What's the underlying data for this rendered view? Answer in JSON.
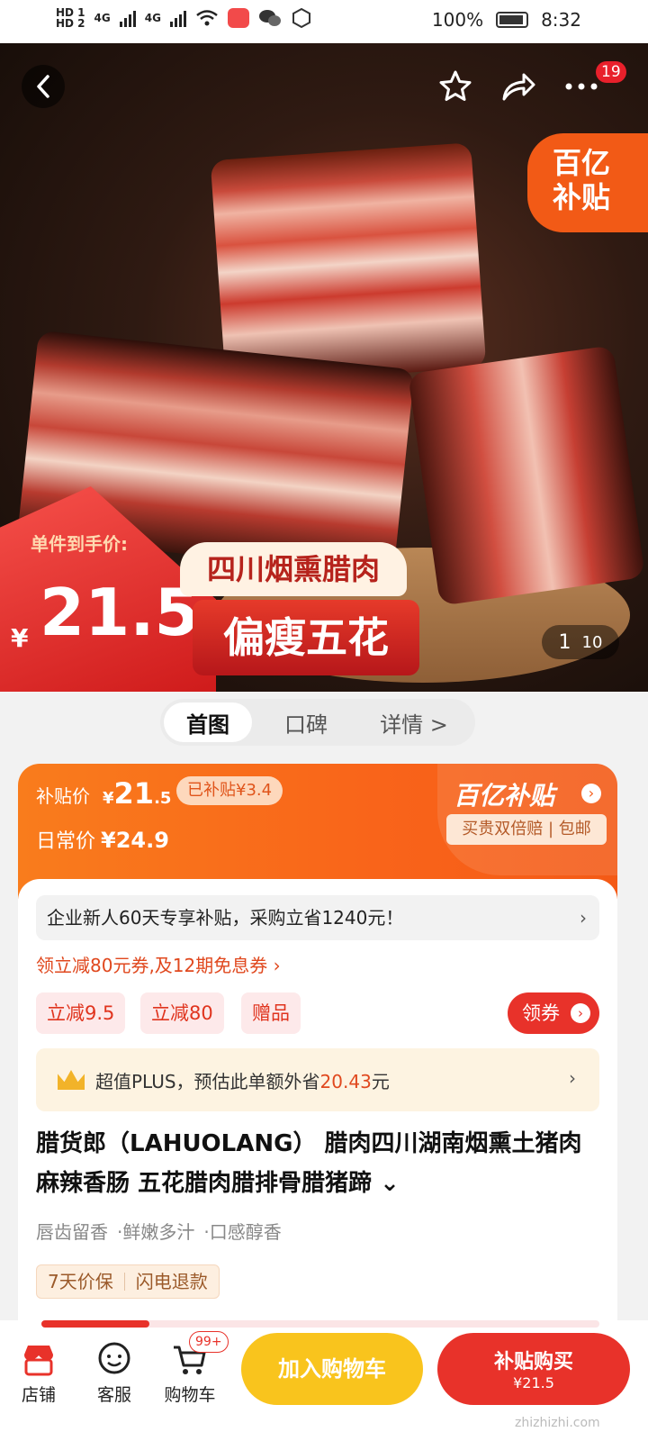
{
  "status_bar": {
    "sim1": "HD 1",
    "sim2": "HD 2",
    "net1": "4G",
    "net2": "4G",
    "battery": "100%",
    "time": "8:32"
  },
  "hero": {
    "fav_icon": "star-icon",
    "share_icon": "share-icon",
    "more_icon": "more-dots-icon",
    "notification_count": "19",
    "yiyi_badge_line1": "百亿",
    "yiyi_badge_line2": "补贴",
    "price_label": "单件到手价:",
    "price_currency": "¥",
    "price_value": "21.5",
    "tag_title": "四川烟熏腊肉",
    "tag_sub": "偏瘦五花",
    "page_current": "1",
    "page_total": "10"
  },
  "tabs": [
    {
      "label": "首图",
      "active": true
    },
    {
      "label": "口碑",
      "active": false
    },
    {
      "label": "详情 >",
      "active": false
    }
  ],
  "subsidy": {
    "label": "补贴价",
    "currency": "¥",
    "price_int": "21",
    "price_dec": ".5",
    "saved": "已补贴¥3.4",
    "regular_label": "日常价",
    "regular_price": "¥24.9",
    "brand": "百亿补贴",
    "guarantee": "买贵双倍赔 | 包邮"
  },
  "promo": {
    "enterprise": "企业新人60天专享补贴，采购立省1240元！",
    "coupon_line": "领立减80元券,及12期免息券 ›",
    "chips": [
      "立减9.5",
      "立减80",
      "赠品"
    ],
    "coupon_button": "领券",
    "plus_prefix": "超值PLUS，预估此单额外省",
    "plus_amount": "20.43",
    "plus_suffix": "元"
  },
  "product": {
    "title": "腊货郎（LAHUOLANG） 腊肉四川湖南烟熏土猪肉麻辣香肠 五花腊肉腊排骨腊猪蹄 ⌄",
    "features": [
      "唇齿留香",
      "·鲜嫩多汁",
      "·口感醇香"
    ],
    "services": [
      "7天价保",
      "闪电退款"
    ]
  },
  "bottom_bar": {
    "store": "店铺",
    "service": "客服",
    "cart": "购物车",
    "cart_badge": "99+",
    "add_to_cart": "加入购物车",
    "buy_line1": "补贴购买",
    "buy_line2": "¥21.5",
    "watermark": "zhizhizhi.com"
  },
  "colors": {
    "accent_red": "#e8322a",
    "subsidy_orange": "#f9641a",
    "cart_yellow": "#f9c41d"
  }
}
